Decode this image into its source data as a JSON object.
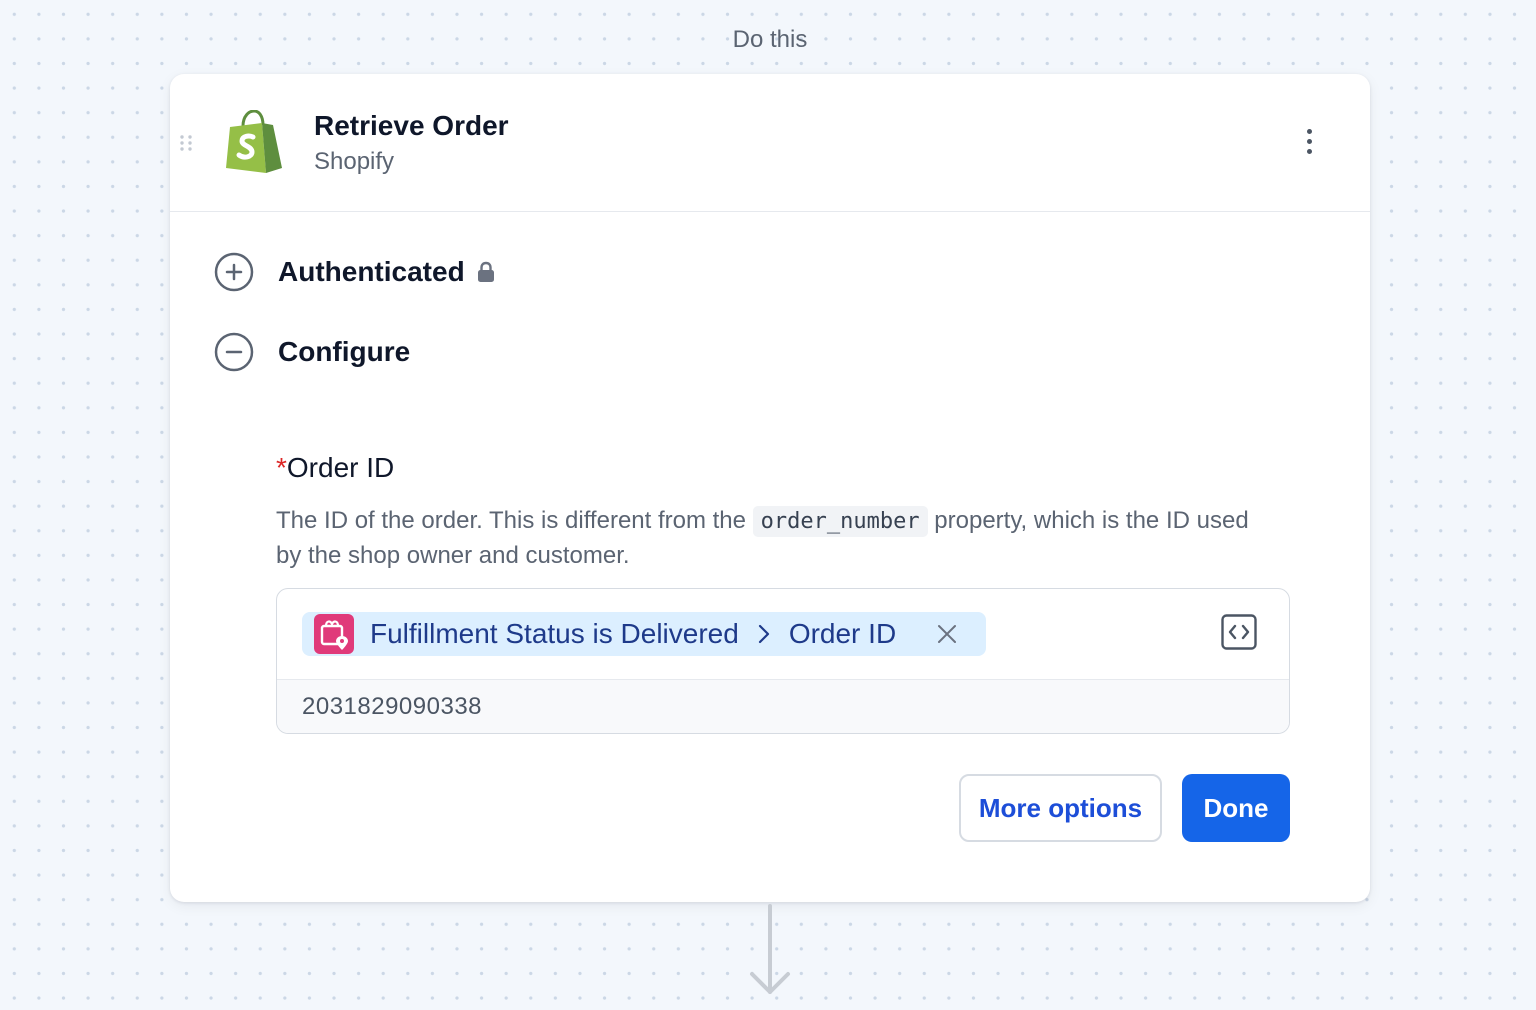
{
  "section_label": "Do this",
  "step": {
    "title": "Retrieve Order",
    "app": "Shopify",
    "app_icon": "shopify-bag-icon",
    "menu_icon": "kebab-menu-icon"
  },
  "sections": {
    "authenticated": {
      "label": "Authenticated",
      "icon": "expand-plus-icon",
      "status_icon": "lock-icon"
    },
    "configure": {
      "label": "Configure",
      "icon": "collapse-minus-icon"
    }
  },
  "field": {
    "required_mark": "*",
    "label": "Order ID",
    "description_before": "The ID of the order. This is different from the ",
    "description_code": "order_number",
    "description_after": " property, which is the ID used by the shop owner and customer.",
    "token": {
      "source": "Fulfillment Status is Delivered",
      "property": "Order ID",
      "icon": "delivery-status-icon"
    },
    "preview_value": "2031829090338"
  },
  "buttons": {
    "more_options": "More options",
    "done": "Done"
  },
  "colors": {
    "primary": "#1565e8",
    "token_bg": "#dcefff",
    "token_text": "#1e3a8a",
    "required": "#dc2626",
    "shopify_green": "#95bf47"
  }
}
